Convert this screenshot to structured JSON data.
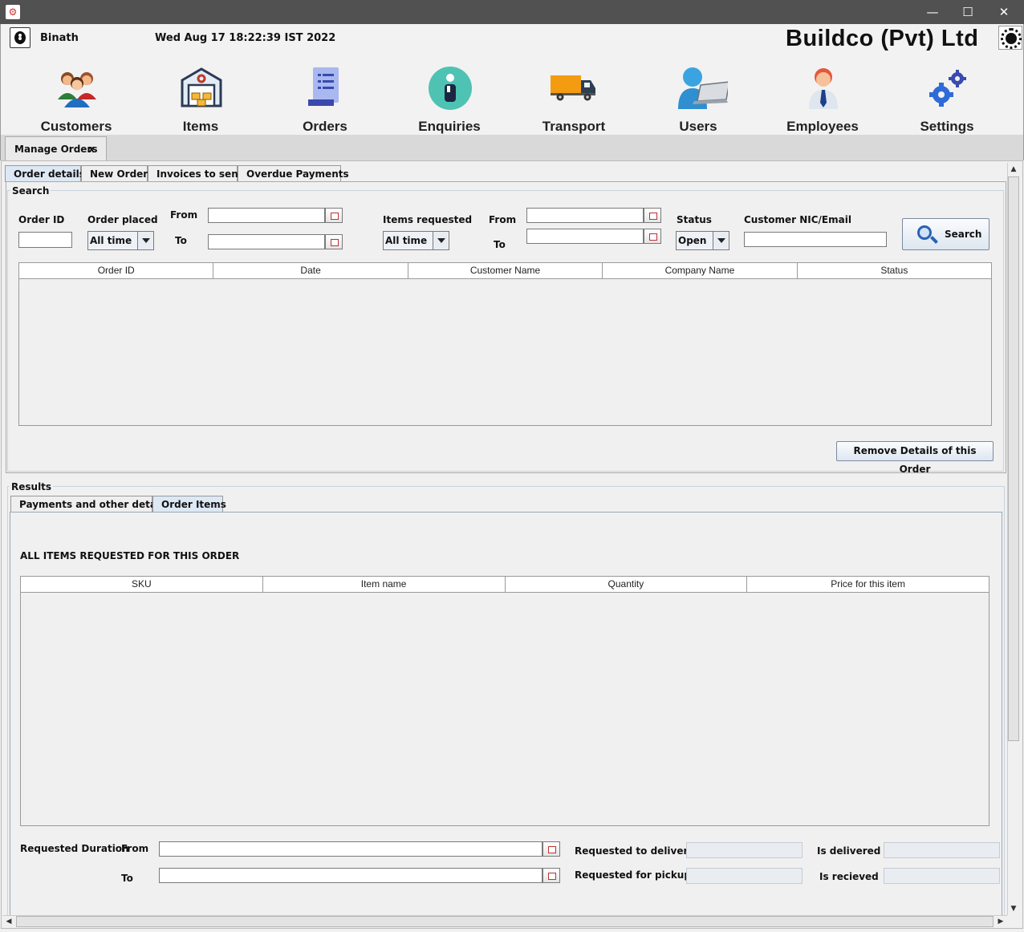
{
  "window": {
    "minimize": "—",
    "maximize": "☐",
    "close": "✕"
  },
  "header": {
    "user_name": "Binath",
    "datetime": "Wed Aug 17 18:22:39 IST 2022",
    "company": "Buildco (Pvt) Ltd"
  },
  "nav": [
    {
      "label": "Customers",
      "icon": "customers-icon"
    },
    {
      "label": "Items",
      "icon": "warehouse-icon"
    },
    {
      "label": "Orders",
      "icon": "orders-icon"
    },
    {
      "label": "Enquiries",
      "icon": "info-icon"
    },
    {
      "label": "Transport",
      "icon": "truck-icon"
    },
    {
      "label": "Users",
      "icon": "user-laptop-icon"
    },
    {
      "label": "Employees",
      "icon": "employee-icon"
    },
    {
      "label": "Settings",
      "icon": "gears-icon"
    }
  ],
  "main_tab": {
    "label": "Manage Orders",
    "close": "x"
  },
  "sub_tabs": [
    "Order details",
    "New Order",
    "Invoices to send",
    "Overdue Payments"
  ],
  "search": {
    "legend": "Search",
    "order_id_label": "Order ID",
    "order_placed_label": "Order placed",
    "order_placed_value": "All time",
    "from_label": "From",
    "to_label": "To",
    "items_requested_label": "Items requested",
    "items_requested_value": "All time",
    "from2_label": "From",
    "to2_label": "To",
    "status_label": "Status",
    "status_value": "Open",
    "customer_label": "Customer NIC/Email",
    "search_button": "Search"
  },
  "orders_table": {
    "columns": [
      "Order ID",
      "Date",
      "Customer Name",
      "Company Name",
      "Status"
    ],
    "rows": []
  },
  "remove_button": "Remove Details of this Order",
  "results": {
    "legend": "Results",
    "tabs": [
      "Payments and other details",
      "Order Items"
    ],
    "heading": "ALL ITEMS REQUESTED FOR THIS ORDER",
    "items_table": {
      "columns": [
        "SKU",
        "Item name",
        "Quantity",
        "Price for this item"
      ],
      "rows": []
    },
    "requested_duration_label": "Requested Duration",
    "from_label": "From",
    "to_label": "To",
    "requested_to_deliver_label": "Requested to deliver",
    "requested_for_pickup_label": "Requested for pickup",
    "is_delivered_label": "Is delivered",
    "is_received_label": "Is recieved"
  }
}
